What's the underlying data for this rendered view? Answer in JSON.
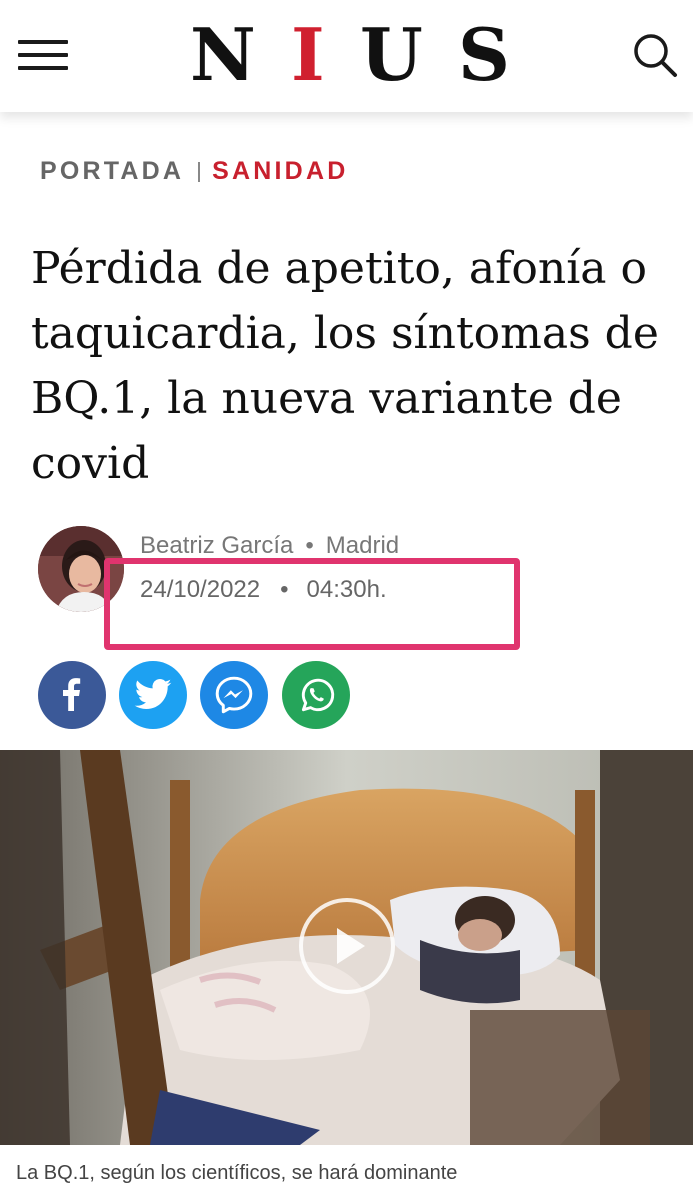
{
  "header": {
    "logo_letters": [
      "N",
      "I",
      "U",
      "S"
    ],
    "accent_color": "#d0202f",
    "menu_icon": "hamburger-menu-icon",
    "search_icon": "search-icon"
  },
  "breadcrumb": {
    "home": "PORTADA",
    "section": "SANIDAD",
    "section_color": "#c8202e"
  },
  "article": {
    "headline": "Pérdida de apetito, afonía o taquicardia, los síntomas de BQ.1, la nueva variante de covid",
    "author": "Beatriz García",
    "location": "Madrid",
    "separator": "•",
    "date": "24/10/2022",
    "time": "04:30h.",
    "highlight_color": "#e0346e"
  },
  "share": [
    {
      "network": "facebook",
      "icon": "facebook-icon",
      "color": "#3b5998"
    },
    {
      "network": "twitter",
      "icon": "twitter-icon",
      "color": "#1da1f2"
    },
    {
      "network": "messenger",
      "icon": "messenger-icon",
      "color": "#1e88e5"
    },
    {
      "network": "whatsapp",
      "icon": "whatsapp-icon",
      "color": "#25a55a"
    }
  ],
  "media": {
    "type": "video",
    "play_icon": "play-icon",
    "caption": "La BQ.1, según los científicos, se hará dominante"
  }
}
